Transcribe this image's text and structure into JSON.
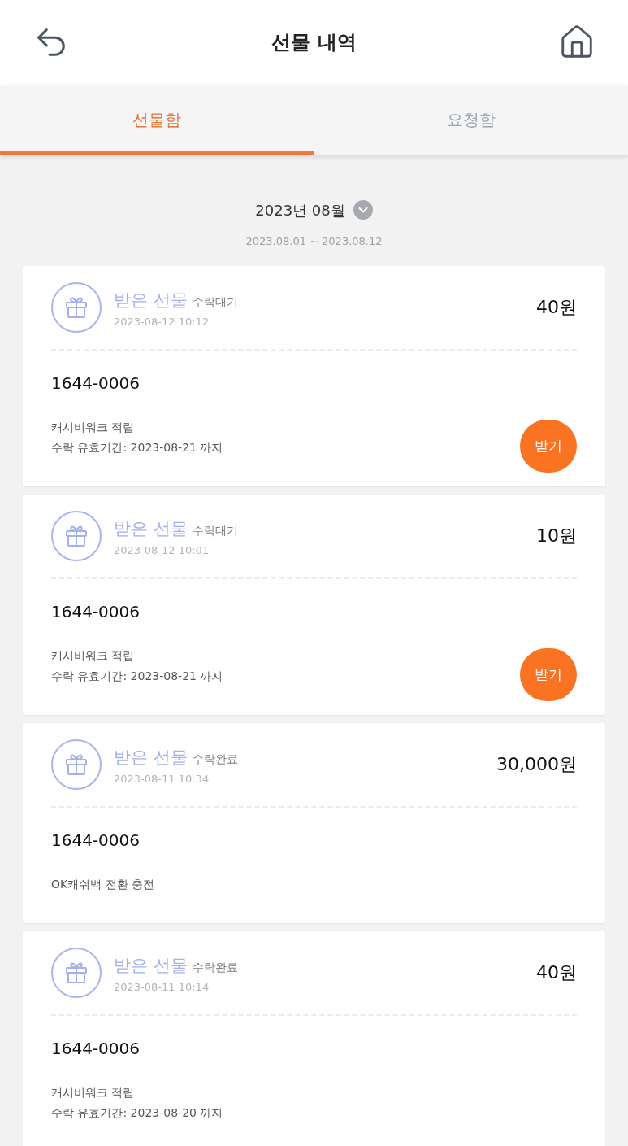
{
  "header": {
    "title": "선물 내역"
  },
  "tabs": [
    {
      "label": "선물함",
      "selected": true
    },
    {
      "label": "요청함",
      "selected": false
    }
  ],
  "period": {
    "month": "2023년 08월",
    "range": "2023.08.01 ~ 2023.08.12"
  },
  "gifts": [
    {
      "title": "받은 선물",
      "status": "수락대기",
      "datetime": "2023-08-12 10:12",
      "amount": "40원",
      "sender": "1644-0006",
      "details": [
        "캐시비워크 적립",
        "수락 유효기간: 2023-08-21 까지"
      ],
      "button": "받기"
    },
    {
      "title": "받은 선물",
      "status": "수락대기",
      "datetime": "2023-08-12 10:01",
      "amount": "10원",
      "sender": "1644-0006",
      "details": [
        "캐시비워크 적립",
        "수락 유효기간: 2023-08-21 까지"
      ],
      "button": "받기"
    },
    {
      "title": "받은 선물",
      "status": "수락완료",
      "datetime": "2023-08-11 10:34",
      "amount": "30,000원",
      "sender": "1644-0006",
      "details": [
        "OK캐쉬백 전환 충전"
      ]
    },
    {
      "title": "받은 선물",
      "status": "수락완료",
      "datetime": "2023-08-11 10:14",
      "amount": "40원",
      "sender": "1644-0006",
      "details": [
        "캐시비워크 적립",
        "수락 유효기간: 2023-08-20 까지"
      ]
    }
  ]
}
